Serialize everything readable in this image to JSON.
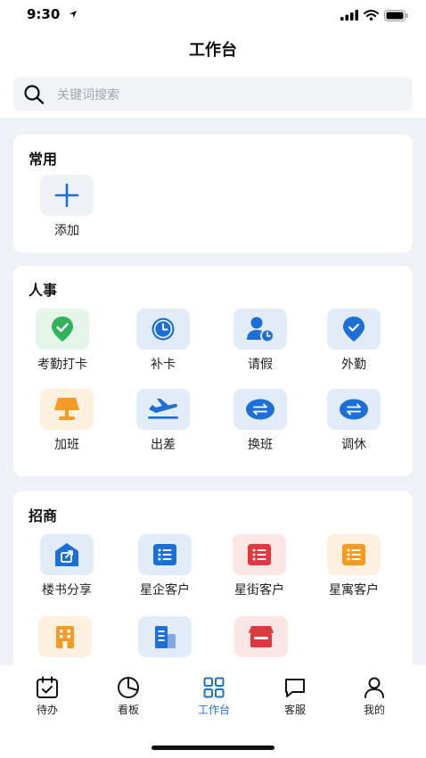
{
  "status_bar": {
    "time": "9:30"
  },
  "header": {
    "title": "工作台"
  },
  "search": {
    "placeholder": "关键词搜索"
  },
  "common": {
    "title": "常用",
    "items": [
      {
        "label": "添加",
        "icon": "plus-icon"
      }
    ]
  },
  "hr": {
    "title": "人事",
    "items": [
      {
        "label": "考勤打卡",
        "icon": "location-check-icon",
        "color": "#2fb45b"
      },
      {
        "label": "补卡",
        "icon": "clock-icon",
        "color": "#1d6fd8"
      },
      {
        "label": "请假",
        "icon": "user-clock-icon",
        "color": "#1d6fd8"
      },
      {
        "label": "外勤",
        "icon": "location-pin-icon",
        "color": "#1d6fd8"
      },
      {
        "label": "加班",
        "icon": "lamp-icon",
        "color": "#f59a23"
      },
      {
        "label": "出差",
        "icon": "airplane-icon",
        "color": "#1d6fd8"
      },
      {
        "label": "换班",
        "icon": "swap-icon",
        "color": "#1d6fd8"
      },
      {
        "label": "调休",
        "icon": "swap-icon",
        "color": "#1d6fd8"
      }
    ]
  },
  "investment": {
    "title": "招商",
    "items": [
      {
        "label": "楼书分享",
        "icon": "house-share-icon",
        "color": "#1d6fd8"
      },
      {
        "label": "星企客户",
        "icon": "list-icon",
        "color": "#1d6fd8"
      },
      {
        "label": "星街客户",
        "icon": "list-icon",
        "color": "#e0383e"
      },
      {
        "label": "星寓客户",
        "icon": "list-icon",
        "color": "#f59a23"
      },
      {
        "label": "",
        "icon": "building-icon",
        "color": "#f59a23"
      },
      {
        "label": "",
        "icon": "office-building-icon",
        "color": "#1d6fd8"
      },
      {
        "label": "",
        "icon": "store-icon",
        "color": "#e0383e"
      }
    ]
  },
  "tabbar": {
    "tabs": [
      {
        "label": "待办",
        "icon": "calendar-check-icon"
      },
      {
        "label": "看板",
        "icon": "pie-chart-icon"
      },
      {
        "label": "工作台",
        "icon": "grid-icon",
        "active": true
      },
      {
        "label": "客服",
        "icon": "chat-icon"
      },
      {
        "label": "我的",
        "icon": "user-icon"
      }
    ]
  },
  "colors": {
    "accent": "#1d6fd8",
    "background": "#eef1f6"
  }
}
